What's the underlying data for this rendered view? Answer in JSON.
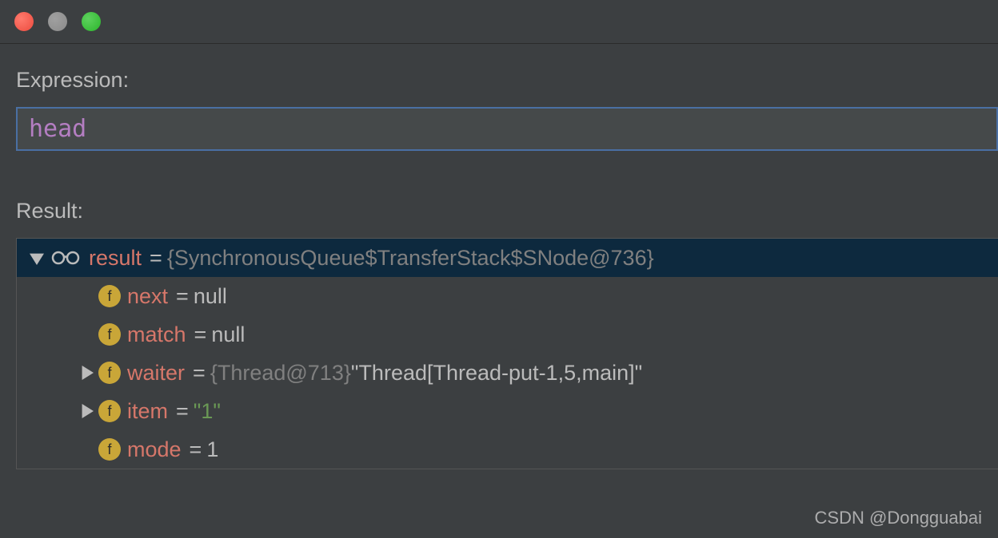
{
  "labels": {
    "expression": "Expression:",
    "result": "Result:"
  },
  "expression_input": {
    "value": "head"
  },
  "tree": {
    "root": {
      "name": "result",
      "equals": "=",
      "value": "{SynchronousQueue$TransferStack$SNode@736}"
    },
    "children": [
      {
        "name": "next",
        "equals": "=",
        "value": "null",
        "has_arrow": false
      },
      {
        "name": "match",
        "equals": "=",
        "value": "null",
        "has_arrow": false
      },
      {
        "name": "waiter",
        "equals": "=",
        "ref": "{Thread@713}",
        "string_value": " \"Thread[Thread-put-1,5,main]\"",
        "has_arrow": true
      },
      {
        "name": "item",
        "equals": "=",
        "string_value": "\"1\"",
        "has_arrow": true
      },
      {
        "name": "mode",
        "equals": "=",
        "value": "1",
        "has_arrow": false
      }
    ]
  },
  "field_icon_letter": "f",
  "watermark": "CSDN @Dongguabai"
}
